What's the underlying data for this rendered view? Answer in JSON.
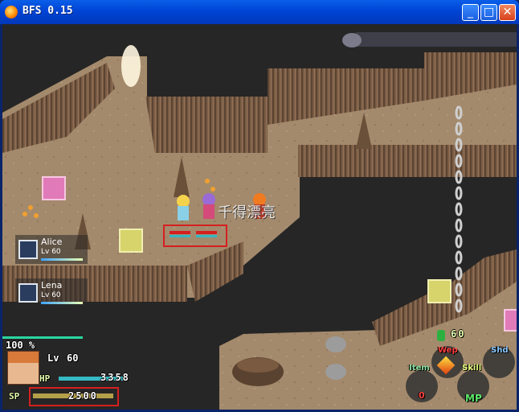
{
  "window": {
    "title": "BFS 0.15",
    "minimize_glyph": "_",
    "maximize_glyph": "□",
    "close_glyph": "✕"
  },
  "watermark": "千得漂亮",
  "party": [
    {
      "name": "Alice",
      "level": "Lv 60",
      "class_icon": "claw-icon"
    },
    {
      "name": "Lena",
      "level": "Lv 60",
      "class_icon": "claw-icon"
    }
  ],
  "player": {
    "percent": "100 %",
    "level_label": "Lv",
    "level_value": "60",
    "hp_label": "HP",
    "hp_value": "3358",
    "sp_label": "SP",
    "sp_value": "2500"
  },
  "inventory": {
    "gem_count": "60"
  },
  "action_menu": {
    "wep": "Wep",
    "shd": "Shd",
    "item": "Item",
    "skill": "Skill",
    "mp": "MP",
    "item_count": "0"
  },
  "colors": {
    "accent_red": "#d42020",
    "hp_bar": "#37b9c4",
    "sp_bar": "#b5a04a",
    "mp_label": "#5ee86a",
    "percent_bar": "#2bd6a0"
  }
}
